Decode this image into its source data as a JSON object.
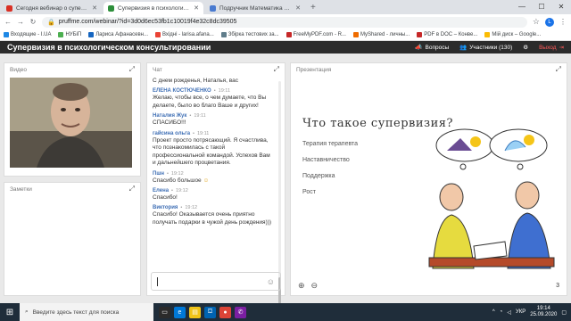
{
  "browser": {
    "tabs": [
      {
        "title": "Сегодня вебинар о супервизии",
        "active": false,
        "color": "#d93025"
      },
      {
        "title": "Супервизия в психологичес",
        "active": true,
        "color": "#2d8f3b"
      },
      {
        "title": "Подручник Математика 6 клас",
        "active": false,
        "color": "#4a7bd0"
      }
    ],
    "url": "pruffme.com/webinar/?id=3d0d6ec53fb1c10019f4e32c8dc39505",
    "profile": "L",
    "bookmarks": [
      {
        "label": "Входящие - I.UA",
        "color": "#1e88e5"
      },
      {
        "label": "НУБіП",
        "color": "#4caf50"
      },
      {
        "label": "Лариса Афанасевн...",
        "color": "#1565c0"
      },
      {
        "label": "Вхідні - larisa.afana...",
        "color": "#ea4335"
      },
      {
        "label": "Збірка тестових за...",
        "color": "#607d8b"
      },
      {
        "label": "FreeMyPDF.com - R...",
        "color": "#c62828"
      },
      {
        "label": "MyShared - личны...",
        "color": "#ef6c00"
      },
      {
        "label": "PDF в DOC – Конве...",
        "color": "#c62828"
      },
      {
        "label": "Мій диск – Google...",
        "color": "#fbbc04"
      }
    ]
  },
  "header": {
    "title": "Супервизия в психологическом консультировании",
    "questions_label": "Вопросы",
    "participants_label": "Участники (130)",
    "exit_label": "Выход"
  },
  "video": {
    "label": "Видео"
  },
  "notes": {
    "label": "Заметки"
  },
  "chat": {
    "label": "Чат",
    "top_text": "С днем рожденья, Наталья, вас",
    "messages": [
      {
        "name": "ЕЛЕНА КОСТЮЧЕНКО",
        "time": "19:11",
        "text": "Желаю, чтобы все, о чем думаете, что Вы делаете, было во благо Ваше и других!"
      },
      {
        "name": "Наталия Жук",
        "time": "19:11",
        "text": "СПАСИБО!!!"
      },
      {
        "name": "гайсина ольга",
        "time": "19:11",
        "text": "Проект просто потрясающий. Я счастлива, что познакомилась с такой профессиональной командой. Успехов Вам и дальнейшего процветания."
      },
      {
        "name": "Пшн",
        "time": "19:12",
        "text": "Спасибо большое"
      },
      {
        "name": "Елена",
        "time": "19:12",
        "text": "Спасибо!"
      },
      {
        "name": "Виктория",
        "time": "19:12",
        "text": "Спасибо! Оказывается очень приятно получать подарки в чужой день рождения)))"
      }
    ]
  },
  "presentation": {
    "label": "Презентация",
    "slide_title": "Что такое супервизия?",
    "items": [
      "Терапия терапевта",
      "Наставничество",
      "Поддержка",
      "Рост"
    ],
    "page": "3"
  },
  "taskbar": {
    "search_placeholder": "Введите здесь текст для поиска",
    "lang": "УКР",
    "time": "19:14",
    "date": "25.09.2020"
  }
}
